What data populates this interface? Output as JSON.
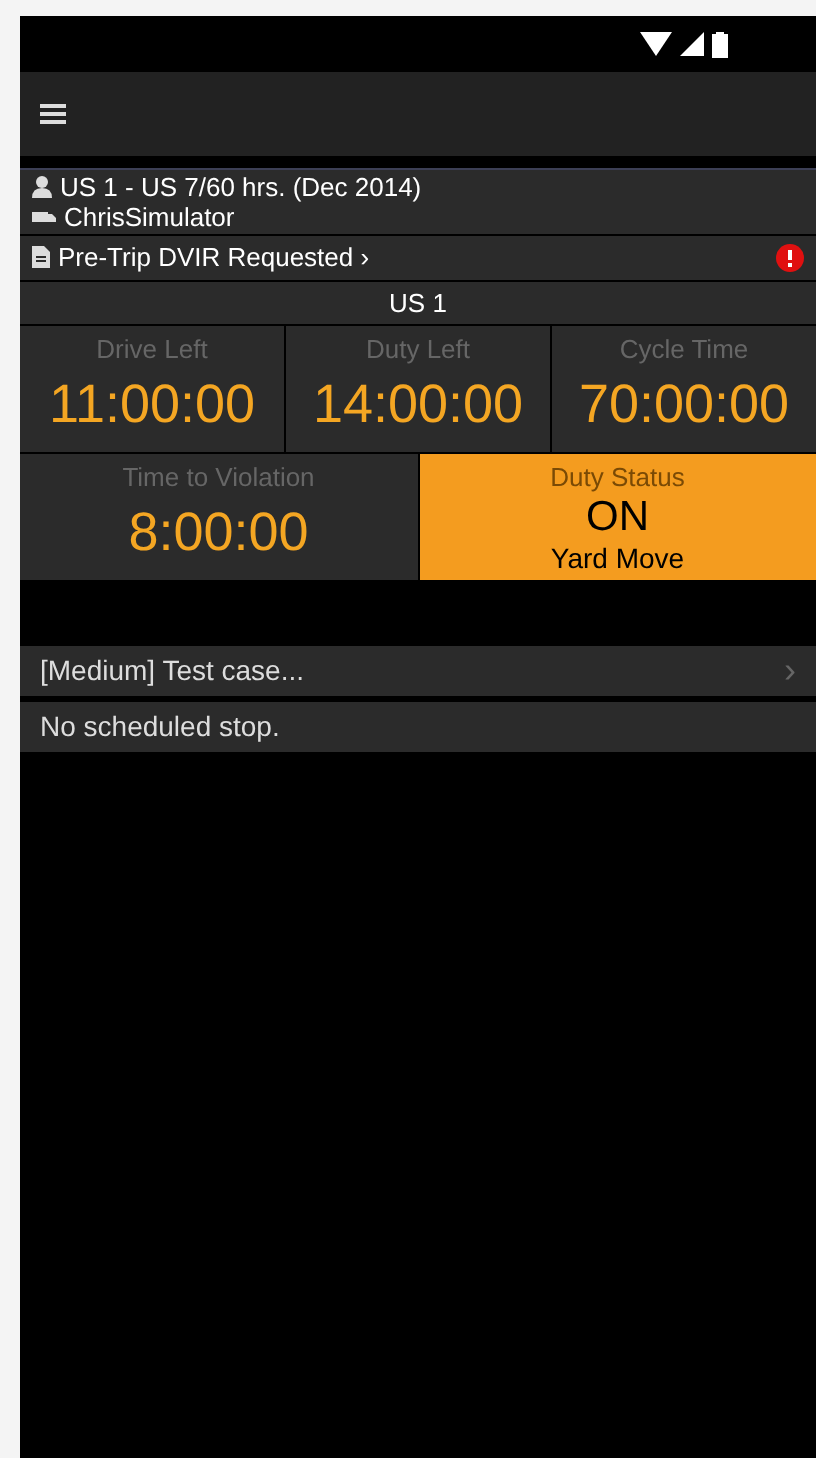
{
  "header": {
    "ruleset": "US 1 - US 7/60 hrs. (Dec 2014)",
    "vehicle": "ChrisSimulator",
    "dvir": "Pre-Trip DVIR Requested",
    "dvir_chevron": "›",
    "dvir_alert": true
  },
  "clocks": {
    "title": "US 1",
    "tiles": [
      {
        "label": "Drive Left",
        "value": "11:00:00",
        "highlighted": false
      },
      {
        "label": "Duty Left",
        "value": "14:00:00",
        "highlighted": false
      },
      {
        "label": "Cycle Time",
        "value": "70:00:00",
        "highlighted": false
      },
      {
        "label": "Time to Violation",
        "value": "8:00:00",
        "highlighted": false
      },
      {
        "label": "Duty Status",
        "value": "ON",
        "sub": "Yard Move",
        "highlighted": true
      }
    ]
  },
  "rows": [
    {
      "text": "[Medium]  Test case...",
      "chevron": "›"
    },
    {
      "text": "No scheduled stop."
    }
  ]
}
